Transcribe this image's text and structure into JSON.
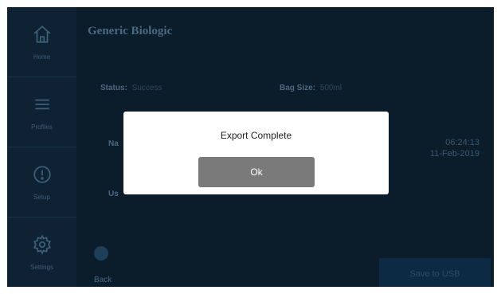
{
  "sidebar": {
    "items": [
      {
        "label": "Home",
        "icon": "home-icon"
      },
      {
        "label": "Profiles",
        "icon": "profiles-icon"
      },
      {
        "label": "Setup",
        "icon": "info-icon"
      },
      {
        "label": "Settings",
        "icon": "gear-icon"
      }
    ]
  },
  "main": {
    "title": "Generic Biologic",
    "status_label": "Status:",
    "status_value": "Success",
    "bag_size_label": "Bag Size:",
    "bag_size_value": "500ml",
    "name_label_partial": "Na",
    "user_label_partial": "Us",
    "time": "06:24:13",
    "date": "11-Feb-2019",
    "back_label": "Back",
    "save_label": "Save to USB"
  },
  "modal": {
    "title": "Export Complete",
    "ok_label": "Ok"
  },
  "colors": {
    "background": "#0b1c2a",
    "sidebar": "#0e2233",
    "modal_button": "#7a7a7a",
    "save_button": "#0d2a44"
  }
}
